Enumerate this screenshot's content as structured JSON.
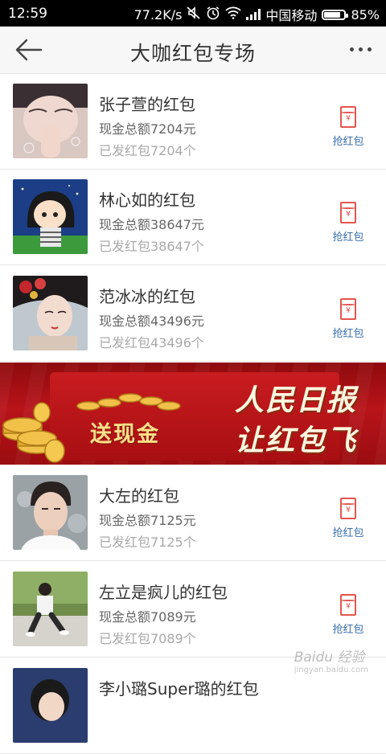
{
  "status_bar": {
    "time": "12:59",
    "speed": "77.2K/s",
    "carrier": "中国移动",
    "battery": "85%",
    "battery_level": 0.85
  },
  "header": {
    "title": "大咖红包专场"
  },
  "items": [
    {
      "name": "张子萱的红包",
      "total": "现金总额7204元",
      "sent": "已发红包7204个",
      "grab_label": "抢红包",
      "envelope_glyph": "¥"
    },
    {
      "name": "林心如的红包",
      "total": "现金总额38647元",
      "sent": "已发红包38647个",
      "grab_label": "抢红包",
      "envelope_glyph": "¥"
    },
    {
      "name": "范冰冰的红包",
      "total": "现金总额43496元",
      "sent": "已发红包43496个",
      "grab_label": "抢红包",
      "envelope_glyph": "¥"
    },
    {
      "name": "大左的红包",
      "total": "现金总额7125元",
      "sent": "已发红包7125个",
      "grab_label": "抢红包",
      "envelope_glyph": "¥"
    },
    {
      "name": "左立是疯儿的红包",
      "total": "现金总额7089元",
      "sent": "已发红包7089个",
      "grab_label": "抢红包",
      "envelope_glyph": "¥"
    },
    {
      "name": "李小璐Super璐的红包"
    }
  ],
  "banner": {
    "left_text": "送现金",
    "right_line1": "人民日报",
    "right_line2": "让红包飞"
  },
  "watermark": {
    "text": "Baidu 经验",
    "sub": "jingyan.baidu.com"
  },
  "colors": {
    "accent_red": "#e4564e",
    "link_blue": "#3a6fb0",
    "banner_red": "#b8141a"
  }
}
